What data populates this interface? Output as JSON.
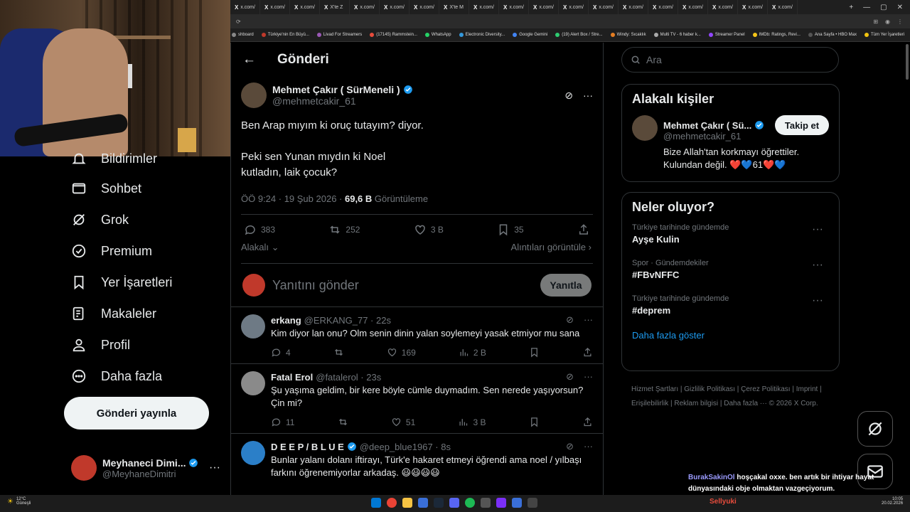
{
  "browser": {
    "tabs": [
      "x.com/",
      "x.com/",
      "x.com/",
      "X'te Z",
      "x.com/",
      "x.com/",
      "x.com/",
      "X'te M",
      "x.com/",
      "x.com/",
      "x.com/",
      "x.com/",
      "x.com/",
      "x.com/",
      "x.com/",
      "x.com/",
      "x.com/",
      "x.com/",
      "x.com/"
    ],
    "bookmarks": [
      "shboard",
      "Türkiye'nin En Büyü...",
      "Livad For Streamers",
      "(17145) Rammstein...",
      "WhatsApp",
      "Electronic Diversity...",
      "Google Gemini",
      "(19) Alert Box / Stre...",
      "Windy: Sıcaklık",
      "Multi TV - 6 haber k...",
      "Streamer Panel",
      "IMDb: Ratings, Revi...",
      "Ana Sayfa • HBO Max",
      "Tüm Yer İşaretleri"
    ]
  },
  "sidebar": {
    "items": [
      {
        "label": "Bildirimler",
        "icon": "bell-icon"
      },
      {
        "label": "Sohbet",
        "icon": "mail-icon"
      },
      {
        "label": "Grok",
        "icon": "grok-icon"
      },
      {
        "label": "Premium",
        "icon": "premium-icon"
      },
      {
        "label": "Yer İşaretleri",
        "icon": "bookmark-icon"
      },
      {
        "label": "Makaleler",
        "icon": "article-icon"
      },
      {
        "label": "Profil",
        "icon": "profile-icon"
      },
      {
        "label": "Daha fazla",
        "icon": "more-icon"
      }
    ],
    "post_button": "Gönderi yayınla",
    "account": {
      "name": "Meyhaneci Dimi...",
      "handle": "@MeyhaneDimitri"
    }
  },
  "main": {
    "title": "Gönderi",
    "tweet": {
      "author": "Mehmet Çakır ( SürMeneli )",
      "handle": "@mehmetcakir_61",
      "text": "Ben Arap mıyım ki oruç tutayım? diyor.\n\nPeki sen Yunan mıydın ki Noel\nkutladın, laik çocuk?",
      "time": "ÖÖ 9:24 · 19 Şub 2026 · ",
      "views": "69,6 B",
      "views_label": " Görüntüleme",
      "replies": "383",
      "retweets": "252",
      "likes": "3 B",
      "bookmarks": "35",
      "relevant": "Alakalı",
      "quotes_link": "Alıntıları görüntüle"
    },
    "reply_placeholder": "Yanıtını gönder",
    "reply_button": "Yanıtla",
    "replies": [
      {
        "name": "erkang",
        "handle": "@ERKANG_77 · 22s",
        "text": "Kim diyor lan onu? Olm senin dinin yalan soylemeyi yasak etmiyor mu sana",
        "replies": "4",
        "retweets": "",
        "likes": "169",
        "views": "2 B"
      },
      {
        "name": "Fatal Erol",
        "handle": "@fatalerol · 23s",
        "text": "Şu yaşıma geldim, bir kere böyle cümle duymadım. Sen nerede yaşıyorsun? Çin mi?",
        "replies": "11",
        "retweets": "",
        "likes": "51",
        "views": "3 B"
      },
      {
        "name": "D E E P / B L U E",
        "handle": "@deep_blue1967 · 8s",
        "text": "Bunlar yalanı dolanı iftirayı, Türk'e hakaret etmeyi öğrendi ama noel / yılbaşı farkını öğrenemiyorlar arkadaş. 😃😃😃😃"
      }
    ]
  },
  "right": {
    "search_placeholder": "Ara",
    "related_title": "Alakalı kişiler",
    "related": {
      "name": "Mehmet Çakır ( Sü...",
      "handle": "@mehmetcakir_61",
      "bio": "Bize Allah'tan korkmayı öğrettiler. Kulundan değil. ❤️💙61❤️💙",
      "follow": "Takip et"
    },
    "trends_title": "Neler oluyor?",
    "trends": [
      {
        "context": "Türkiye tarihinde gündemde",
        "topic": "Ayşe Kulin"
      },
      {
        "context": "Spor · Gündemdekiler",
        "topic": "#FBvNFFC"
      },
      {
        "context": "Türkiye tarihinde gündemde",
        "topic": "#deprem"
      }
    ],
    "show_more": "Daha fazla göster",
    "footer": "Hizmet Şartları  |  Gizlilik Politikası  |  Çerez Politikası  |  Imprint  |  Erişilebilirlik  |  Reklam bilgisi  |  Daha fazla ···  © 2026 X Corp."
  },
  "overlay": {
    "chat_user": "BurakSakinOl",
    "chat_text": "hoşçakal oxxe. ben artık bir ihtiyar hayat dünyasındaki obje olmaktan vazgeçiyorum.",
    "follower_alert": "Sellyuki"
  },
  "taskbar": {
    "weather": "12°C",
    "weather_desc": "Güneşli",
    "time": "10:05",
    "date": "20.02.2026"
  },
  "colors": {
    "accent": "#1d9bf0",
    "bg": "#000000",
    "border": "#2f3336",
    "muted": "#71767b"
  }
}
